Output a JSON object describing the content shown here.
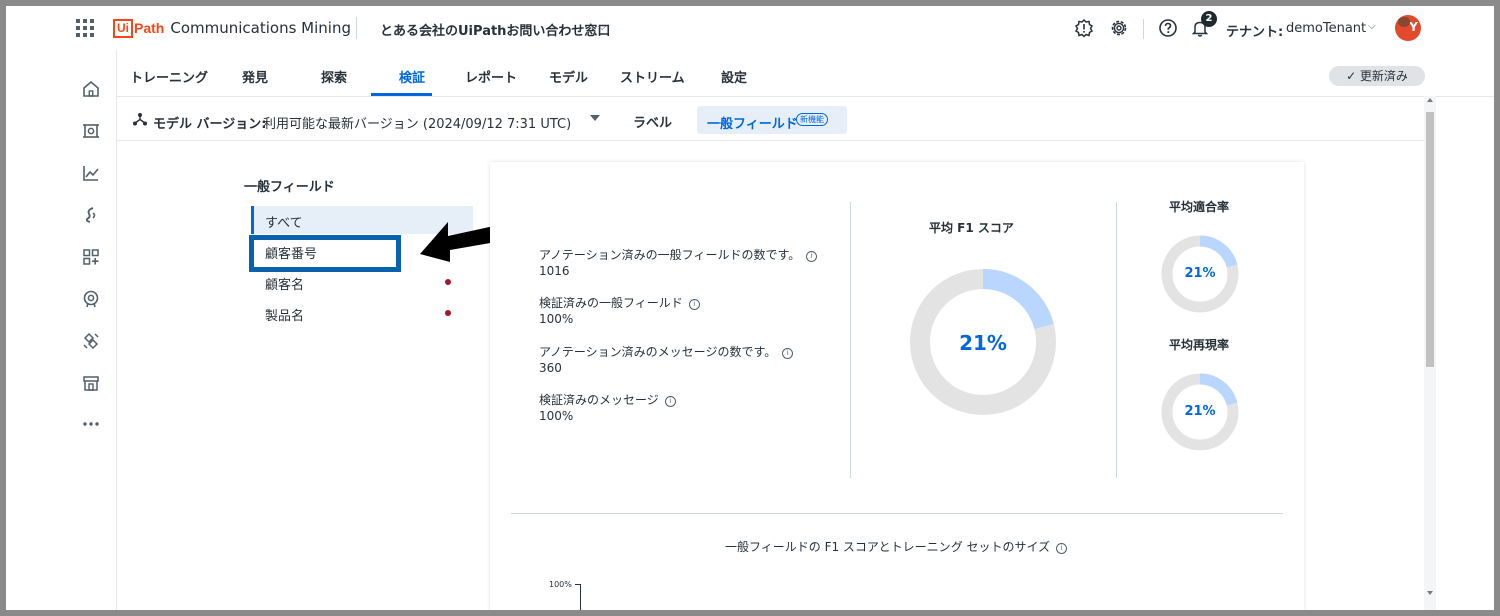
{
  "header": {
    "logo_ui": "Ui",
    "logo_path": "Path",
    "product": "Communications Mining",
    "project": "とある会社のUiPathお問い合わせ窓口",
    "notification_count": "2",
    "tenant_label": "テナント:",
    "tenant_name": "demoTenant",
    "avatar_letter": "Y"
  },
  "tabs": [
    {
      "label": "トレーニング"
    },
    {
      "label": "発見"
    },
    {
      "label": "探索"
    },
    {
      "label": "検証"
    },
    {
      "label": "レポート"
    },
    {
      "label": "モデル"
    },
    {
      "label": "ストリーム"
    },
    {
      "label": "設定"
    }
  ],
  "active_tab": "検証",
  "status_pill": "✓ 更新済み",
  "toolbar": {
    "model_version_label": "モデル バージョン:",
    "model_version_value": "利用可能な最新バージョン (2024/09/12 7:31 UTC)",
    "label_button": "ラベル",
    "general_fields_button": "一般フィールド",
    "new_badge": "新機能"
  },
  "fields_panel": {
    "title": "一般フィールド",
    "items": [
      {
        "label": "すべて"
      },
      {
        "label": "顧客番号"
      },
      {
        "label": "顧客名"
      },
      {
        "label": "製品名"
      }
    ]
  },
  "stats": [
    {
      "label": "アノテーション済みの一般フィールドの数です。",
      "value": "1016"
    },
    {
      "label": "検証済みの一般フィールド",
      "value": "100%"
    },
    {
      "label": "アノテーション済みのメッセージの数です。",
      "value": "360"
    },
    {
      "label": "検証済みのメッセージ",
      "value": "100%"
    }
  ],
  "metrics": {
    "f1": {
      "title": "平均 F1 スコア",
      "value_text": "21%",
      "fraction": 0.21
    },
    "precision": {
      "title": "平均適合率",
      "value_text": "21%",
      "fraction": 0.21
    },
    "recall": {
      "title": "平均再現率",
      "value_text": "21%",
      "fraction": 0.21
    }
  },
  "chart": {
    "title": "一般フィールドの F1 スコアとトレーニング セットのサイズ",
    "y_top_tick": "100%"
  },
  "colors": {
    "accent": "#0067df",
    "donut_fill": "#b8d6ff",
    "donut_track": "#e3e3e3",
    "highlight": "#0a62ac",
    "dot": "#a6172b"
  }
}
